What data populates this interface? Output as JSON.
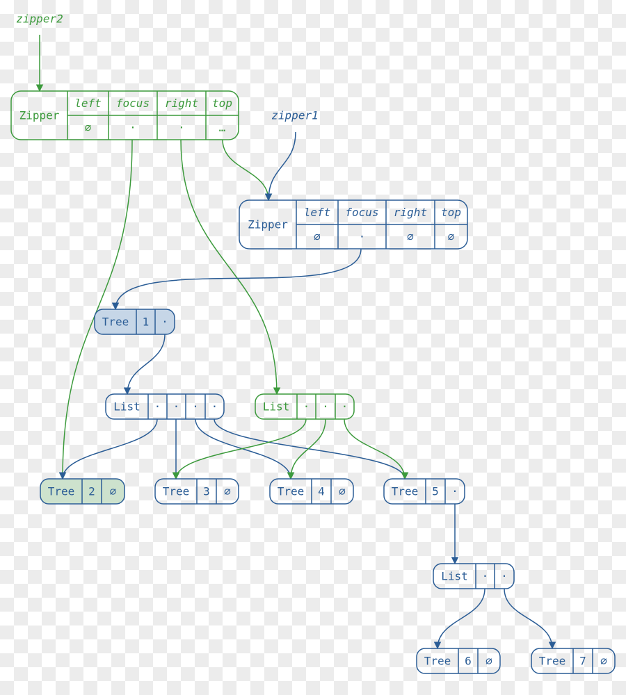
{
  "colors": {
    "green": "#3c9a3c",
    "blue": "#2b5d96",
    "tree1_fill": "#c6d6e7",
    "tree2_fill": "#cde2cd"
  },
  "labels": {
    "zipper2": "zipper2",
    "zipper1": "zipper1"
  },
  "nodes": {
    "zipper2": {
      "title": "Zipper",
      "headers": [
        "left",
        "focus",
        "right",
        "top"
      ],
      "values": [
        "∅",
        "·",
        "·",
        "…"
      ]
    },
    "zipper1": {
      "title": "Zipper",
      "headers": [
        "left",
        "focus",
        "right",
        "top"
      ],
      "values": [
        "∅",
        "·",
        "∅",
        "∅"
      ]
    },
    "tree1": {
      "cells": [
        "Tree",
        "1",
        "·"
      ]
    },
    "list1": {
      "cells": [
        "List",
        "·",
        "·",
        "·",
        "·"
      ]
    },
    "list2": {
      "cells": [
        "List",
        "·",
        "·",
        "·"
      ]
    },
    "tree2": {
      "cells": [
        "Tree",
        "2",
        "∅"
      ]
    },
    "tree3": {
      "cells": [
        "Tree",
        "3",
        "∅"
      ]
    },
    "tree4": {
      "cells": [
        "Tree",
        "4",
        "∅"
      ]
    },
    "tree5": {
      "cells": [
        "Tree",
        "5",
        "·"
      ]
    },
    "list3": {
      "cells": [
        "List",
        "·",
        "·"
      ]
    },
    "tree6": {
      "cells": [
        "Tree",
        "6",
        "∅"
      ]
    },
    "tree7": {
      "cells": [
        "Tree",
        "7",
        "∅"
      ]
    }
  }
}
